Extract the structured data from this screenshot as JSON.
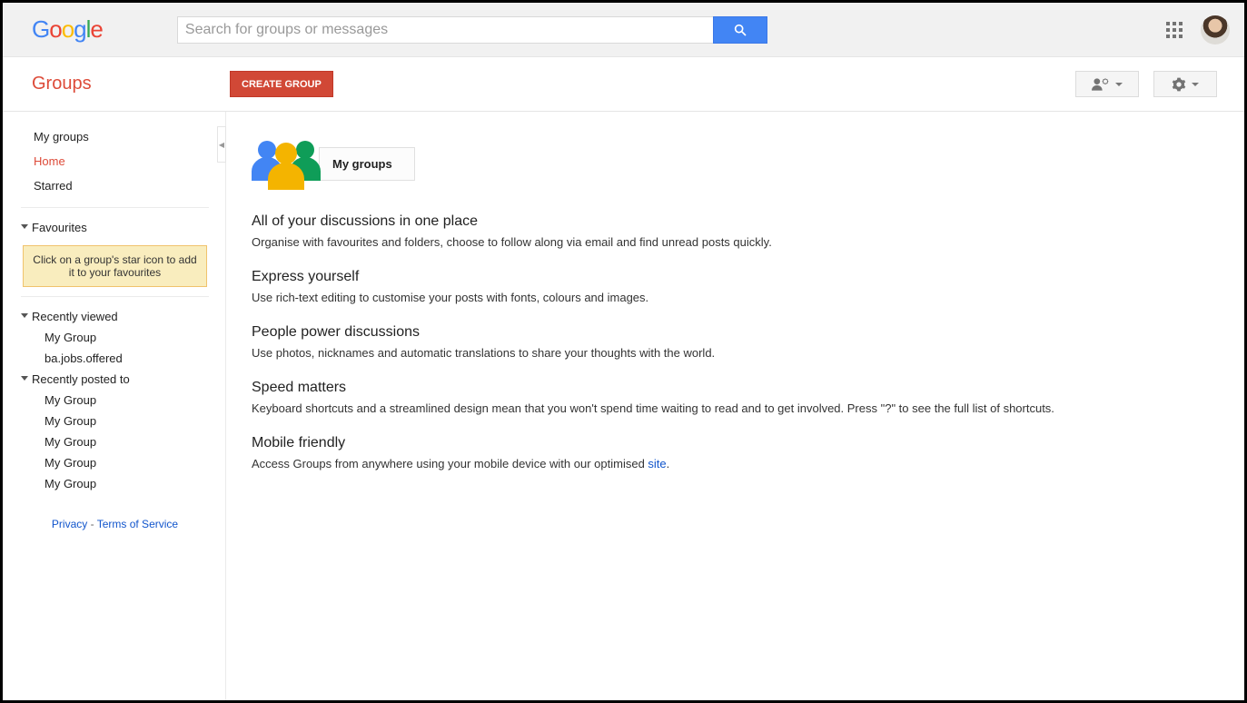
{
  "header": {
    "search_placeholder": "Search for groups or messages"
  },
  "subbar": {
    "app_title": "Groups",
    "create_label": "CREATE GROUP"
  },
  "sidebar": {
    "nav": [
      "My groups",
      "Home",
      "Starred"
    ],
    "active_index": 1,
    "favourites_label": "Favourites",
    "favourites_tip": "Click on a group's star icon to add it to your favourites",
    "recently_viewed_label": "Recently viewed",
    "recently_viewed": [
      "My Group",
      "ba.jobs.offered"
    ],
    "recently_posted_label": "Recently posted to",
    "recently_posted": [
      "My Group",
      "My Group",
      "My Group",
      "My Group",
      "My Group"
    ],
    "footer": {
      "privacy": "Privacy",
      "tos": "Terms of Service"
    }
  },
  "main": {
    "hero_title": "My groups",
    "features": [
      {
        "title": "All of your discussions in one place",
        "desc": "Organise with favourites and folders, choose to follow along via email and find unread posts quickly."
      },
      {
        "title": "Express yourself",
        "desc": "Use rich-text editing to customise your posts with fonts, colours and images."
      },
      {
        "title": "People power discussions",
        "desc": "Use photos, nicknames and automatic translations to share your thoughts with the world."
      },
      {
        "title": "Speed matters",
        "desc": "Keyboard shortcuts and a streamlined design mean that you won't spend time waiting to read and to get involved. Press \"?\" to see the full list of shortcuts."
      },
      {
        "title": "Mobile friendly",
        "desc_prefix": "Access Groups from anywhere using your mobile device with our optimised ",
        "link_text": "site",
        "desc_suffix": "."
      }
    ]
  }
}
